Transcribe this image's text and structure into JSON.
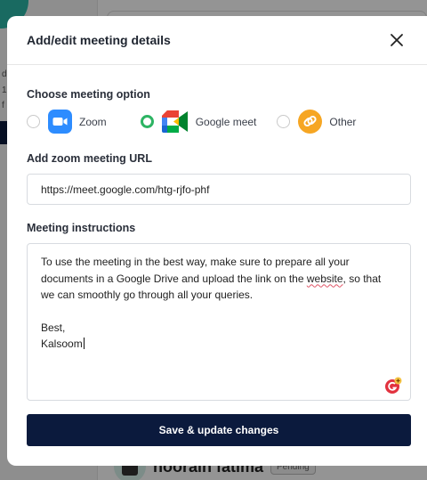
{
  "modal": {
    "title": "Add/edit meeting details",
    "option_section_label": "Choose meeting option",
    "options": [
      {
        "label": "Zoom",
        "selected": false,
        "icon": "zoom-icon",
        "color": "#2d8cff"
      },
      {
        "label": "Google meet",
        "selected": true,
        "icon": "google-meet-icon",
        "color": "#00ac47"
      },
      {
        "label": "Other",
        "selected": false,
        "icon": "other-link-icon",
        "color": "#f6a623"
      }
    ],
    "url_label": "Add zoom meeting URL",
    "url_value": "https://meet.google.com/htg-rjfo-phf",
    "instructions_label": "Meeting instructions",
    "instructions": {
      "line1_before": "To use the meeting in the best way, make sure to prepare all your documents in a Google Drive and upload the link on the ",
      "line1_misspelled": "website",
      "line1_after": ", so that we can smoothly go through all your queries.",
      "sign_off": "Best,",
      "signature": "Kalsoom"
    },
    "save_label": "Save & update changes",
    "accent_color": "#0b1a3d",
    "selected_radio_color": "#2db463"
  },
  "background": {
    "user_name": "noorain fatima",
    "status_badge": "Pending",
    "left_fragments": [
      "d S",
      "1",
      "f"
    ]
  }
}
